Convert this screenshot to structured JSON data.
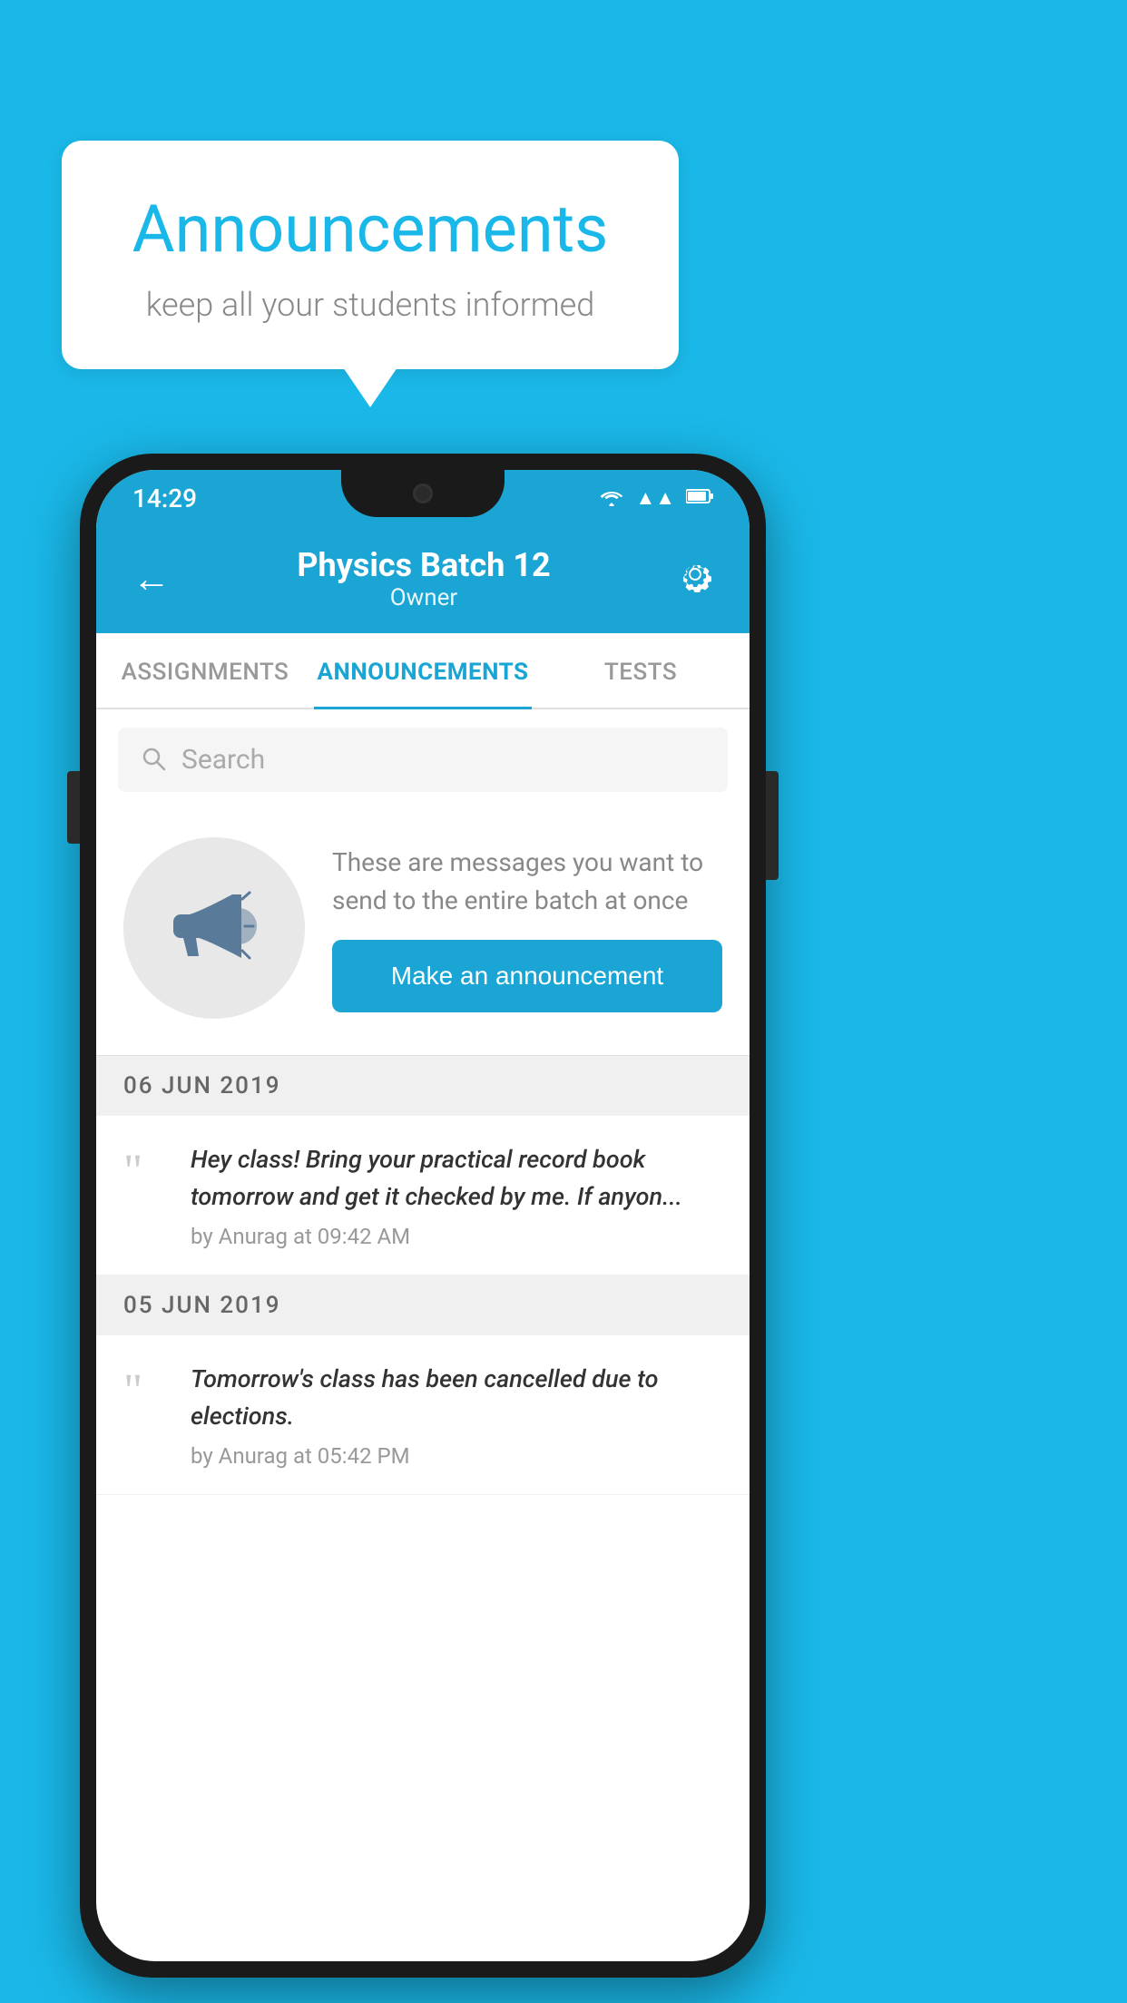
{
  "background_color": "#1ab8e8",
  "speech_bubble": {
    "title": "Announcements",
    "subtitle": "keep all your students informed"
  },
  "phone": {
    "status_bar": {
      "time": "14:29",
      "wifi": "▼",
      "signal": "▲",
      "battery": "▮"
    },
    "header": {
      "back_label": "←",
      "title": "Physics Batch 12",
      "subtitle": "Owner",
      "settings_label": "⚙"
    },
    "tabs": [
      {
        "label": "ASSIGNMENTS",
        "active": false
      },
      {
        "label": "ANNOUNCEMENTS",
        "active": true
      },
      {
        "label": "TESTS",
        "active": false
      }
    ],
    "search": {
      "placeholder": "Search"
    },
    "promo": {
      "description": "These are messages you want to\nsend to the entire batch at once",
      "button_label": "Make an announcement"
    },
    "announcements": [
      {
        "date": "06  JUN  2019",
        "text": "Hey class! Bring your practical record book tomorrow and get it checked by me. If anyon...",
        "meta": "by Anurag at 09:42 AM"
      },
      {
        "date": "05  JUN  2019",
        "text": "Tomorrow's class has been cancelled due to elections.",
        "meta": "by Anurag at 05:42 PM"
      }
    ]
  }
}
